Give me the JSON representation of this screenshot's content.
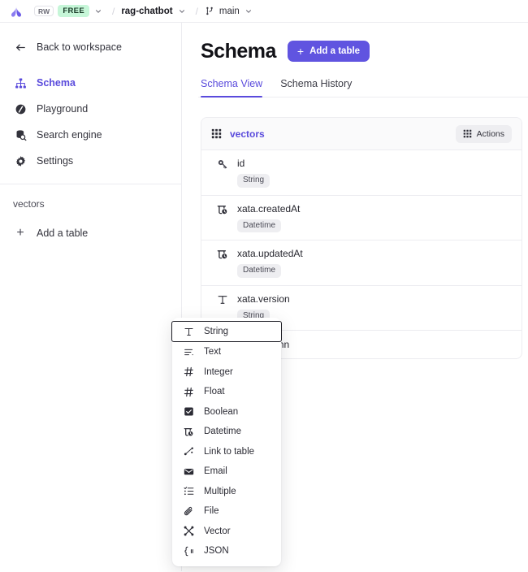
{
  "topbar": {
    "logo_icon": "xata-butterfly-logo",
    "workspace_badge": "RW",
    "plan_badge": "FREE",
    "plan_chevron_icon": "chevron-down-icon",
    "separator": "/",
    "database_name": "rag-chatbot",
    "database_chevron_icon": "chevron-down-icon",
    "separator2": "/",
    "branch_icon": "git-branch-icon",
    "branch_name": "main",
    "branch_chevron_icon": "chevron-down-icon"
  },
  "sidebar": {
    "back_label": "Back to workspace",
    "back_icon": "arrow-left-icon",
    "items": [
      {
        "label": "Schema",
        "icon": "schema-hierarchy-icon",
        "active": true
      },
      {
        "label": "Playground",
        "icon": "playground-icon",
        "active": false
      },
      {
        "label": "Search engine",
        "icon": "search-engine-icon",
        "active": false
      },
      {
        "label": "Settings",
        "icon": "gear-icon",
        "active": false
      }
    ],
    "table_group_label": "vectors",
    "add_table_label": "Add a table",
    "add_table_icon": "plus-icon"
  },
  "main": {
    "page_title": "Schema",
    "add_table_button": "Add a table",
    "add_table_button_icon": "plus-icon",
    "tabs": [
      {
        "label": "Schema View",
        "active": true
      },
      {
        "label": "Schema History",
        "active": false
      }
    ]
  },
  "table_card": {
    "grid_icon": "grid-icon",
    "table_name": "vectors",
    "actions_label": "Actions",
    "actions_icon": "grid-icon",
    "columns": [
      {
        "name": "id",
        "type": "String",
        "icon": "key-icon"
      },
      {
        "name": "xata.createdAt",
        "type": "Datetime",
        "icon": "datetime-icon"
      },
      {
        "name": "xata.updatedAt",
        "type": "Datetime",
        "icon": "datetime-icon"
      },
      {
        "name": "xata.version",
        "type": "String",
        "icon": "text-string-icon"
      }
    ],
    "add_column_label": "Add a column",
    "add_column_icon": "plus-icon"
  },
  "type_dropdown": {
    "items": [
      {
        "label": "String",
        "icon": "text-string-icon",
        "selected": true
      },
      {
        "label": "Text",
        "icon": "text-lines-icon",
        "selected": false
      },
      {
        "label": "Integer",
        "icon": "hash-icon",
        "selected": false
      },
      {
        "label": "Float",
        "icon": "hash-icon",
        "selected": false
      },
      {
        "label": "Boolean",
        "icon": "checkbox-icon",
        "selected": false
      },
      {
        "label": "Datetime",
        "icon": "datetime-icon",
        "selected": false
      },
      {
        "label": "Link to table",
        "icon": "link-nodes-icon",
        "selected": false
      },
      {
        "label": "Email",
        "icon": "envelope-icon",
        "selected": false
      },
      {
        "label": "Multiple",
        "icon": "list-check-icon",
        "selected": false
      },
      {
        "label": "File",
        "icon": "paperclip-icon",
        "selected": false
      },
      {
        "label": "Vector",
        "icon": "vector-nodes-icon",
        "selected": false
      },
      {
        "label": "JSON",
        "icon": "json-braces-icon",
        "selected": false
      }
    ]
  },
  "colors": {
    "brand_purple": "#6054E0",
    "link_purple": "#5A4BDC",
    "free_badge_bg": "#C6F6D8",
    "border": "#ECECF0",
    "tag_bg": "#EEEEF1"
  }
}
